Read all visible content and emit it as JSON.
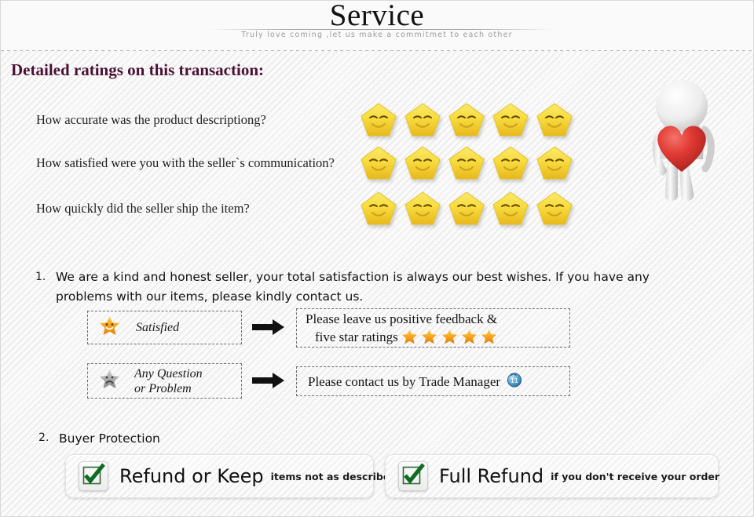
{
  "header": {
    "title": "Service",
    "subtitle": "Truly love coming ,let us make a commitmet to each other"
  },
  "section": {
    "title": "Detailed ratings on this transaction:"
  },
  "ratings": {
    "star_count": 5,
    "star_icon": "smiley-star-icon",
    "rows": [
      {
        "question": "How accurate was the product descriptiong?",
        "stars": 5
      },
      {
        "question": "How satisfied were you with the seller`s communication?",
        "stars": 5
      },
      {
        "question": "How quickly did the seller ship the item?",
        "stars": 5
      }
    ]
  },
  "figure": {
    "icon": "3d-person-holding-heart-icon",
    "heart_color": "#e03a33",
    "body_color": "#f0f0f0"
  },
  "list": {
    "item1": {
      "number": "1.",
      "text": "We are a kind and honest seller, your total satisfaction is always our best wishes. If you have any problems with our items, please kindly contact us."
    },
    "item2": {
      "number": "2.",
      "label": "Buyer Protection"
    }
  },
  "flow": {
    "rows": [
      {
        "icon": "happy-star-icon",
        "icon_color": "#f5a11d",
        "left_label": "Satisfied",
        "left_label_line2": "",
        "arrow": "arrow-right-icon",
        "right_text": "Please leave us positive feedback &",
        "right_text_line2": "five star ratings",
        "right_stars": 5,
        "right_star_icon": "orange-star-icon",
        "right_trailing_icon": ""
      },
      {
        "icon": "sad-star-icon",
        "icon_color": "#9a9a9a",
        "left_label": "Any Question",
        "left_label_line2": "or Problem",
        "arrow": "arrow-right-icon",
        "right_text": "Please contact us by Trade Manager",
        "right_text_line2": "",
        "right_stars": 0,
        "right_star_icon": "",
        "right_trailing_icon": "trade-manager-icon"
      }
    ]
  },
  "protection": {
    "buttons": [
      {
        "checkbox_icon": "green-check-icon",
        "main": "Refund or Keep",
        "sub": "items not as described"
      },
      {
        "checkbox_icon": "green-check-icon",
        "main": "Full Refund",
        "sub": "if you don't receive your order"
      }
    ]
  },
  "colors": {
    "title": "#4a1033",
    "star_yellow": "#f2d23a",
    "star_orange": "#f0951c",
    "check_green": "#1a7a2e",
    "heart_red": "#e03a33"
  }
}
